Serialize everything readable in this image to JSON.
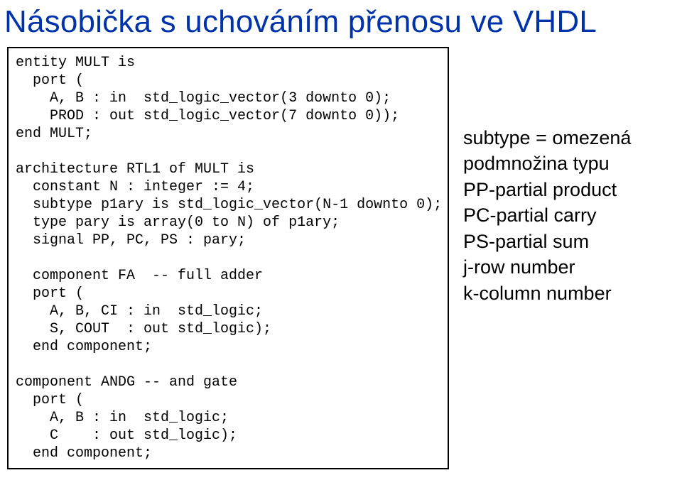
{
  "title": "Násobička s uchováním přenosu ve VHDL",
  "code": "entity MULT is\n  port (\n    A, B : in  std_logic_vector(3 downto 0);\n    PROD : out std_logic_vector(7 downto 0));\nend MULT;\n\narchitecture RTL1 of MULT is\n  constant N : integer := 4;\n  subtype p1ary is std_logic_vector(N-1 downto 0);\n  type pary is array(0 to N) of p1ary;\n  signal PP, PC, PS : pary;\n\n  component FA  -- full adder\n  port (\n    A, B, CI : in  std_logic;\n    S, COUT  : out std_logic);\n  end component;\n\ncomponent ANDG -- and gate\n  port (\n    A, B : in  std_logic;\n    C    : out std_logic);\n  end component;",
  "annotations": {
    "l1": "subtype = omezená",
    "l2": "podmnožina typu",
    "l3": "PP-partial product",
    "l4": "PC-partial carry",
    "l5": "PS-partial sum",
    "l6": "j-row number",
    "l7": "k-column number"
  }
}
